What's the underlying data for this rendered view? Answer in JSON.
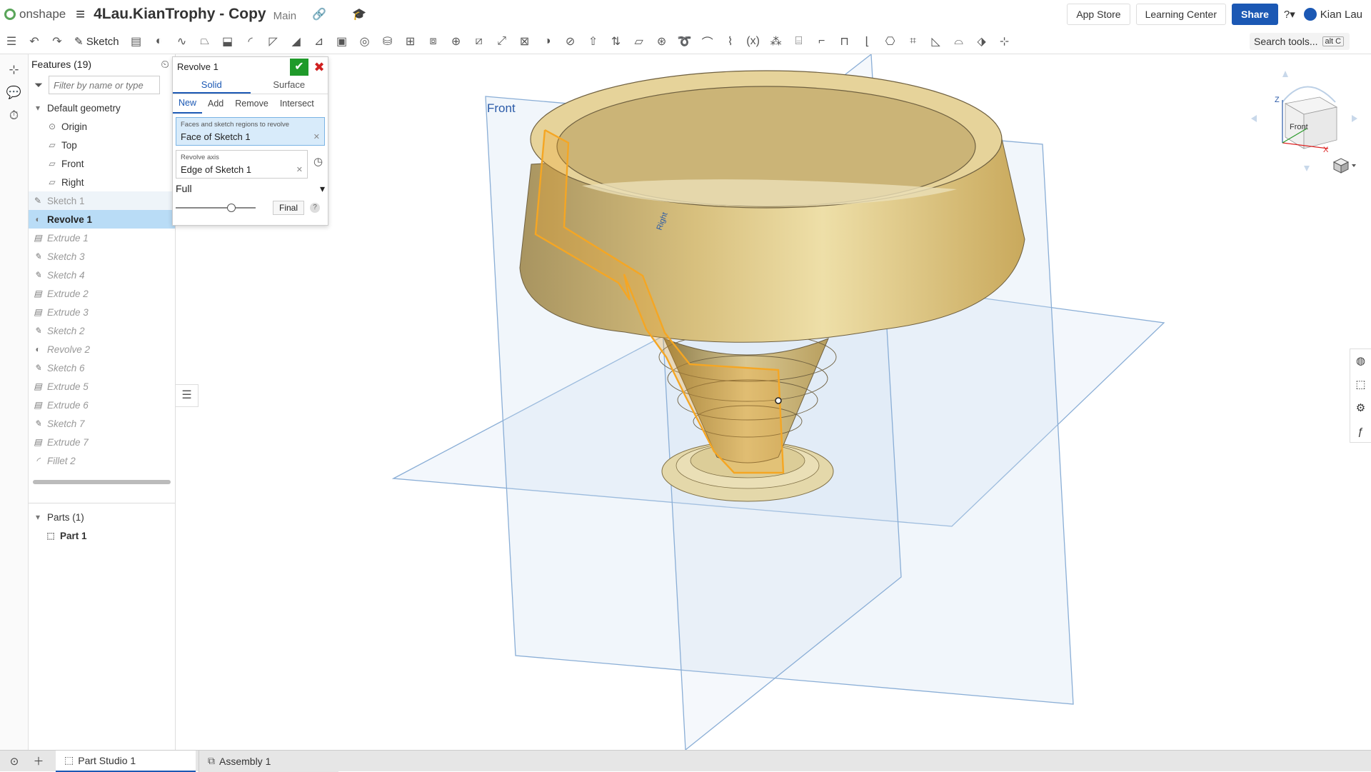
{
  "header": {
    "logo_text": "onshape",
    "doc_title": "4Lau.KianTrophy - Copy",
    "branch": "Main",
    "buttons": {
      "app_store": "App Store",
      "learning_center": "Learning Center",
      "share": "Share"
    },
    "help": "?",
    "user_name": "Kian Lau"
  },
  "toolbar": {
    "sketch_label": "Sketch",
    "variable_label": "(x)",
    "search_label": "Search tools...",
    "search_shortcut": "alt C"
  },
  "features": {
    "title": "Features (19)",
    "filter_placeholder": "Filter by name or type",
    "group_label": "Default geometry",
    "default_items": [
      "Origin",
      "Top",
      "Front",
      "Right"
    ],
    "items": [
      "Sketch 1",
      "Revolve 1",
      "Extrude 1",
      "Sketch 3",
      "Sketch 4",
      "Extrude 2",
      "Extrude 3",
      "Sketch 2",
      "Revolve 2",
      "Sketch 6",
      "Extrude 5",
      "Extrude 6",
      "Sketch 7",
      "Extrude 7",
      "Fillet 2"
    ],
    "parts_label": "Parts (1)",
    "part_name": "Part 1"
  },
  "dialog": {
    "title": "Revolve 1",
    "tabs": [
      "Solid",
      "Surface"
    ],
    "operations": [
      "New",
      "Add",
      "Remove",
      "Intersect"
    ],
    "faces_label": "Faces and sketch regions to revolve",
    "faces_value": "Face of Sketch 1",
    "axis_label": "Revolve axis",
    "axis_value": "Edge of Sketch 1",
    "revolve_type": "Full",
    "final_button": "Final",
    "slider_position": 0.7
  },
  "viewport": {
    "front_plane_label": "Front",
    "right_plane_label": "Right",
    "viewcube_face": "Front",
    "axis_x": "X",
    "axis_z": "Z",
    "colors": {
      "plane_stroke": "#8aaed6",
      "sketch_orange": "#f5a623",
      "part_gold": "#d8c27e"
    }
  },
  "bottom": {
    "tabs": [
      "Part Studio 1",
      "Assembly 1"
    ]
  }
}
